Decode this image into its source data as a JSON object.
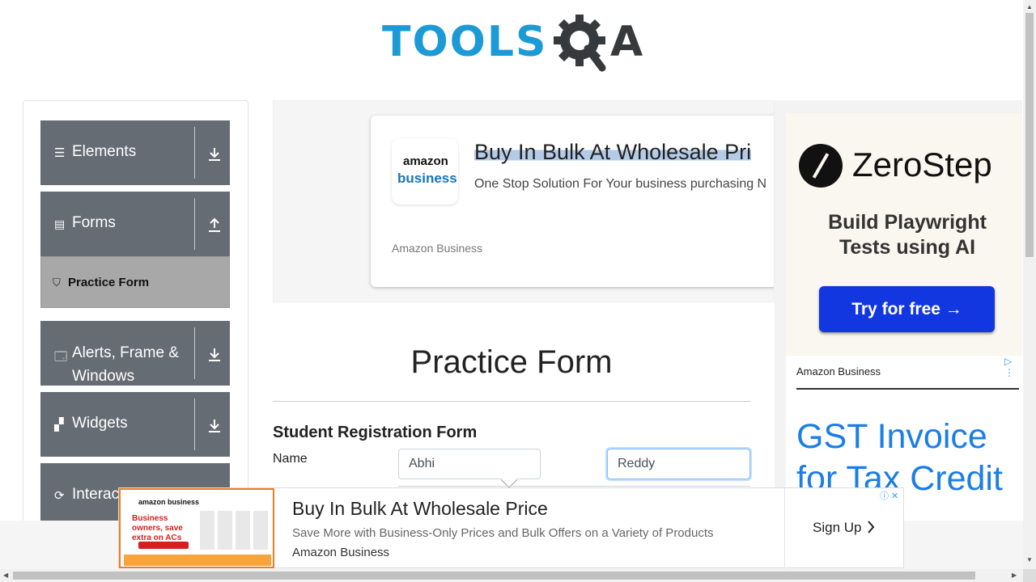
{
  "header": {
    "logo_text": "TOOLS",
    "logo_suffix": "A"
  },
  "sidebar": {
    "groups": [
      {
        "label": "Elements",
        "icon": "menu-icon",
        "arrow": "download-arrow"
      },
      {
        "label": "Forms",
        "icon": "document-icon",
        "arrow": "upload-arrow"
      },
      {
        "label": "Alerts, Frame &",
        "label2": "Windows",
        "icon": "window-icon",
        "arrow": "download-arrow"
      },
      {
        "label": "Widgets",
        "icon": "widgets-icon",
        "arrow": "download-arrow"
      },
      {
        "label": "Interac",
        "icon": "interaction-icon",
        "arrow": "download-arrow"
      }
    ],
    "active_item": {
      "label": "Practice Form",
      "icon": "html5-icon"
    }
  },
  "top_ad": {
    "logo_line1": "amazon",
    "logo_line2": "business",
    "title": "Buy In Bulk At Wholesale Pri",
    "subtitle": "One Stop Solution For Your business purchasing N",
    "brand": "Amazon Business"
  },
  "right_ad": {
    "zerostep_name": "ZeroStep",
    "tagline_line1": "Build Playwright",
    "tagline_line2": "Tests using AI",
    "cta": "Try for free →",
    "brand": "Amazon Business",
    "headline_line1": "GST Invoice",
    "headline_line2": "for Tax Credit"
  },
  "form": {
    "page_title": "Practice Form",
    "heading": "Student Registration Form",
    "name_label": "Name",
    "first_name": "Abhi",
    "last_name": "Reddy"
  },
  "bottom_ad": {
    "thumb_brand": "amazon business",
    "thumb_text": "Business owners, save extra on ACs",
    "title": "Buy In Bulk At Wholesale Price",
    "subtitle": "Save More with Business-Only Prices and Bulk Offers on a Variety of Products",
    "brand": "Amazon Business",
    "cta": "Sign Up"
  },
  "colors": {
    "brand_blue": "#1b9ad6",
    "sidebar_bg": "#666c74",
    "active_bg": "#a8a8a8",
    "cta_blue": "#1237e0"
  }
}
